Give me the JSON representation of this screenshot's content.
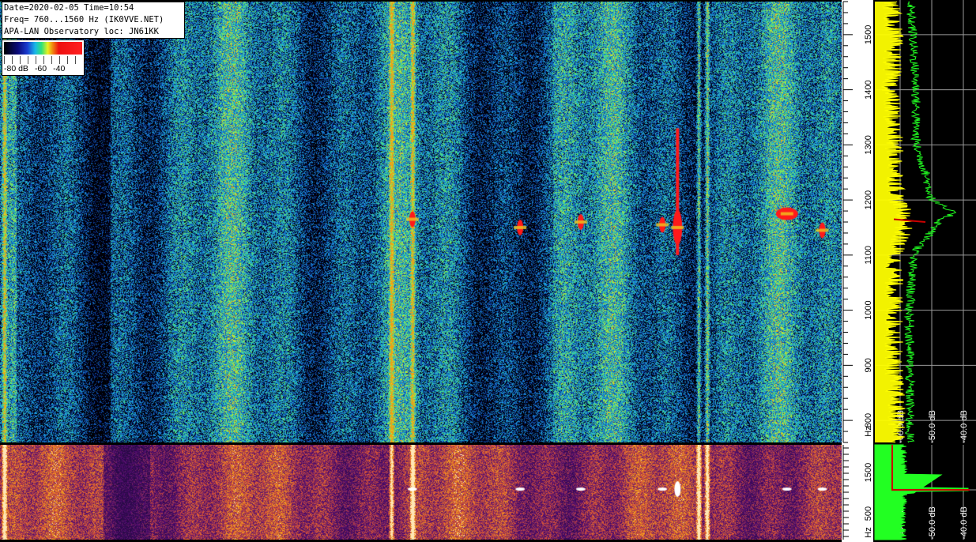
{
  "header": {
    "line1": "Date=2020-02-05 Time=10:54",
    "line2": "Freq= 760...1560 Hz (IK0VVE.NET)",
    "line3": "APA-LAN Observatory loc: JN61KK"
  },
  "color_scale": {
    "labels": [
      "-80 dB",
      "-60",
      "-40"
    ]
  },
  "colors": {
    "background": "#000000",
    "spectrum_peak": "#ffff00",
    "spectrum_avg": "#22ff22",
    "spectrum_marker": "#cc0000",
    "gridline": "#9a9a9a",
    "axis_text": "#ffffff"
  },
  "chart_data": [
    {
      "type": "heatmap",
      "name_hint": "spectrogram-upper",
      "y_axis": {
        "unit": "Hz",
        "range": [
          760,
          1560
        ],
        "ticks": [
          800,
          900,
          1000,
          1100,
          1200,
          1300,
          1400,
          1500
        ],
        "unit_label": "Hz"
      },
      "vertical_bands_x_fraction": [
        0.005,
        0.465,
        0.49,
        0.83,
        0.84
      ],
      "signals": [
        {
          "x_fraction": 0.49,
          "freq": 1165,
          "intensity": "red"
        },
        {
          "x_fraction": 0.618,
          "freq": 1150,
          "intensity": "red"
        },
        {
          "x_fraction": 0.69,
          "freq": 1160,
          "intensity": "red"
        },
        {
          "x_fraction": 0.787,
          "freq": 1155,
          "intensity": "red"
        },
        {
          "x_fraction": 0.805,
          "freq": 1150,
          "intensity": "red",
          "extent": [
            1100,
            1330
          ]
        },
        {
          "x_fraction": 0.935,
          "freq": 1175,
          "intensity": "red"
        },
        {
          "x_fraction": 0.977,
          "freq": 1145,
          "intensity": "red"
        }
      ]
    },
    {
      "type": "line",
      "name_hint": "spectrum-upper",
      "x_axis": {
        "ticks": [
          "-60.0 dB",
          "-50.0 dB",
          "-40.0 dB"
        ]
      },
      "y_axis": {
        "unit": "Hz",
        "range": [
          760,
          1560
        ]
      },
      "series": [
        {
          "color": "#ffff00",
          "points": [
            [
              1560,
              -63
            ],
            [
              1500,
              -62
            ],
            [
              1400,
              -63
            ],
            [
              1300,
              -62
            ],
            [
              1200,
              -61
            ],
            [
              1165,
              -58
            ],
            [
              1100,
              -62
            ],
            [
              1000,
              -62
            ],
            [
              900,
              -62
            ],
            [
              800,
              -61
            ],
            [
              760,
              -61
            ]
          ]
        },
        {
          "color": "#22ff22",
          "points": [
            [
              1560,
              -57
            ],
            [
              1500,
              -56
            ],
            [
              1400,
              -55
            ],
            [
              1300,
              -55
            ],
            [
              1250,
              -52
            ],
            [
              1200,
              -50
            ],
            [
              1175,
              -43
            ],
            [
              1165,
              -47
            ],
            [
              1100,
              -56
            ],
            [
              1000,
              -57
            ],
            [
              900,
              -57
            ],
            [
              800,
              -57
            ],
            [
              760,
              -57
            ]
          ]
        }
      ]
    },
    {
      "type": "heatmap",
      "name_hint": "spectrogram-lower",
      "y_axis": {
        "unit": "Hz",
        "ticks": [
          500,
          1500
        ],
        "unit_label": "Hz"
      }
    },
    {
      "type": "line",
      "name_hint": "spectrum-lower",
      "x_axis": {
        "ticks": [
          "-60.0 dB",
          "-50.0 dB",
          "-40.0 dB"
        ]
      }
    }
  ]
}
